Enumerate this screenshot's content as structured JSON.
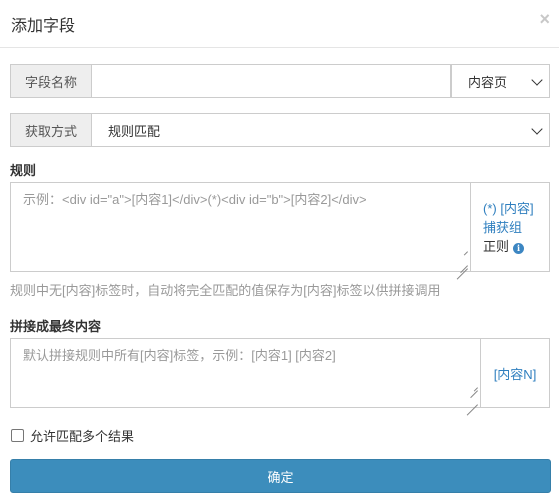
{
  "dialog": {
    "title": "添加字段",
    "close_symbol": "×"
  },
  "field_name": {
    "addon": "字段名称",
    "value": "",
    "source_select": "内容页"
  },
  "method": {
    "addon": "获取方式",
    "select": "规则匹配"
  },
  "rule": {
    "label": "规则",
    "placeholder": "示例：<div id=\"a\">[内容1]</div>(*)<div id=\"b\">[内容2]</div>",
    "side_link_line1": "(*) [内容]",
    "side_link_line2": "捕获组",
    "side_text": "正则",
    "info_glyph": "i"
  },
  "rule_help": "规则中无[内容]标签时，自动将完全匹配的值保存为[内容]标签以供拼接调用",
  "concat": {
    "label": "拼接成最终内容",
    "placeholder": "默认拼接规则中所有[内容]标签，示例：[内容1] [内容2]",
    "side_link": "[内容N]"
  },
  "allow_multiple": {
    "label": "允许匹配多个结果",
    "checked": false
  },
  "confirm_button": "确定",
  "colors": {
    "primary": "#3c8dbc",
    "link": "#2f7fbf",
    "addon_bg": "#eeeeee",
    "border": "#cccccc"
  }
}
